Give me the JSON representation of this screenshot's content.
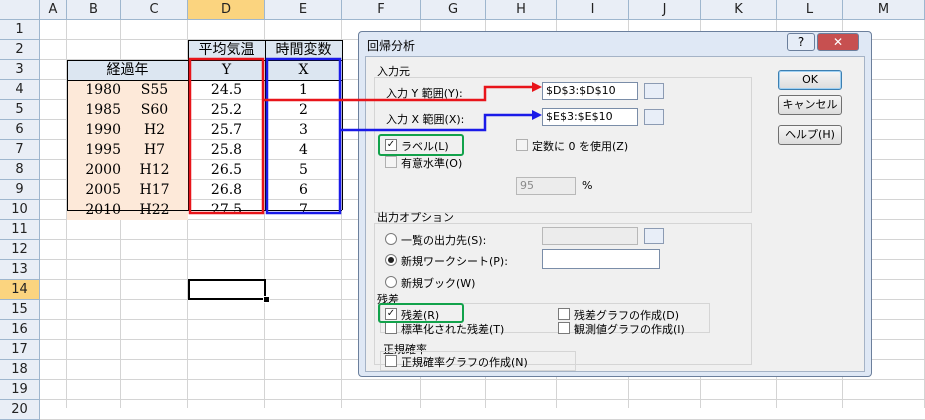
{
  "spreadsheet": {
    "columns": [
      "A",
      "B",
      "C",
      "D",
      "E",
      "F",
      "G",
      "H",
      "I",
      "J",
      "K",
      "L",
      "M"
    ],
    "rows": [
      "1",
      "2",
      "3",
      "4",
      "5",
      "6",
      "7",
      "8",
      "9",
      "10",
      "11",
      "12",
      "13",
      "14",
      "15",
      "16",
      "17",
      "18",
      "19",
      "20"
    ],
    "selected_column": "D",
    "selected_row": "14",
    "header_d": "平均気温",
    "header_e": "時間変数",
    "header_b": "経過年",
    "label_y": "Y",
    "label_x": "X",
    "data_rows": [
      {
        "year": "1980",
        "era": "S55",
        "y": "24.5",
        "x": "1"
      },
      {
        "year": "1985",
        "era": "S60",
        "y": "25.2",
        "x": "2"
      },
      {
        "year": "1990",
        "era": "H2",
        "y": "25.7",
        "x": "3"
      },
      {
        "year": "1995",
        "era": "H7",
        "y": "25.8",
        "x": "4"
      },
      {
        "year": "2000",
        "era": "H12",
        "y": "26.5",
        "x": "5"
      },
      {
        "year": "2005",
        "era": "H17",
        "y": "26.8",
        "x": "6"
      },
      {
        "year": "2010",
        "era": "H22",
        "y": "27.5",
        "x": "7"
      }
    ]
  },
  "dialog": {
    "title": "回帰分析",
    "help_icon": "?",
    "close_icon": "✕",
    "input_section": "入力元",
    "input_y_label": "入力 Y 範囲(Y):",
    "input_y_value": "$D$3:$D$10",
    "input_x_label": "入力 X 範囲(X):",
    "input_x_value": "$E$3:$E$10",
    "labels_check": "ラベル(L)",
    "constant_zero": "定数に 0 を使用(Z)",
    "confidence_check": "有意水準(O)",
    "confidence_value": "95",
    "confidence_unit": "%",
    "output_section": "出力オプション",
    "output_range": "一覧の出力先(S):",
    "new_sheet": "新規ワークシート(P):",
    "new_book": "新規ブック(W)",
    "residuals_section": "残差",
    "residuals": "残差(R)",
    "standardized_residuals": "標準化された残差(T)",
    "residual_plots": "残差グラフの作成(D)",
    "line_fit_plots": "観測値グラフの作成(I)",
    "normal_section": "正規確率",
    "normal_plots": "正規確率グラフの作成(N)",
    "ok": "OK",
    "cancel": "キャンセル",
    "help": "ヘルプ(H)",
    "labels_checked": true,
    "residuals_checked": true,
    "new_sheet_selected": true
  },
  "annotations": {
    "red": "#e8141a",
    "blue": "#1a1ae8",
    "green": "#12a24b"
  }
}
